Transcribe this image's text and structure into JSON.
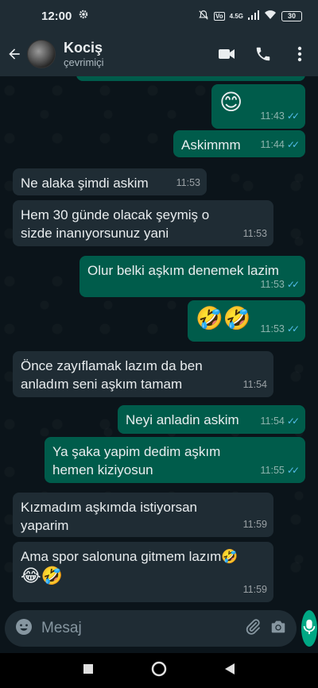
{
  "status": {
    "time": "12:00",
    "signal": "4.5G",
    "battery": "30"
  },
  "header": {
    "name": "Kociş",
    "presence": "çevrimiçi"
  },
  "messages": [
    {
      "dir": "out",
      "text": "😊",
      "time": "11:43"
    },
    {
      "dir": "out",
      "text": "Askimmm",
      "time": "11:44"
    },
    {
      "dir": "in",
      "text": "Ne alaka şimdi askim",
      "time": "11:53"
    },
    {
      "dir": "in",
      "text": "Hem 30 günde olacak şeymiş o sizde inanıyorsunuz yani",
      "time": "11:53"
    },
    {
      "dir": "out",
      "text": "Olur belki aşkım denemek lazim",
      "time": "11:53"
    },
    {
      "dir": "out",
      "text": "🤣🤣",
      "time": "11:53"
    },
    {
      "dir": "in",
      "text": "Önce zayıflamak lazım da ben anladım seni aşkım tamam",
      "time": "11:54"
    },
    {
      "dir": "out",
      "text": "Neyi anladin askim",
      "time": "11:54"
    },
    {
      "dir": "out",
      "text": "Ya şaka yapim dedim aşkım hemen kiziyosun",
      "time": "11:55"
    },
    {
      "dir": "in",
      "text": "Kızmadım aşkımda istiyorsan yaparim",
      "time": "11:59"
    },
    {
      "dir": "in",
      "text": "Ama spor salonuna gitmem lazım🤣",
      "text2": "😂🤣",
      "time": "11:59"
    }
  ],
  "input": {
    "placeholder": "Mesaj"
  },
  "colors": {
    "outgoing": "#005c4b",
    "incoming": "#1f2c34",
    "accent": "#00a884",
    "read_tick": "#53bdeb"
  }
}
